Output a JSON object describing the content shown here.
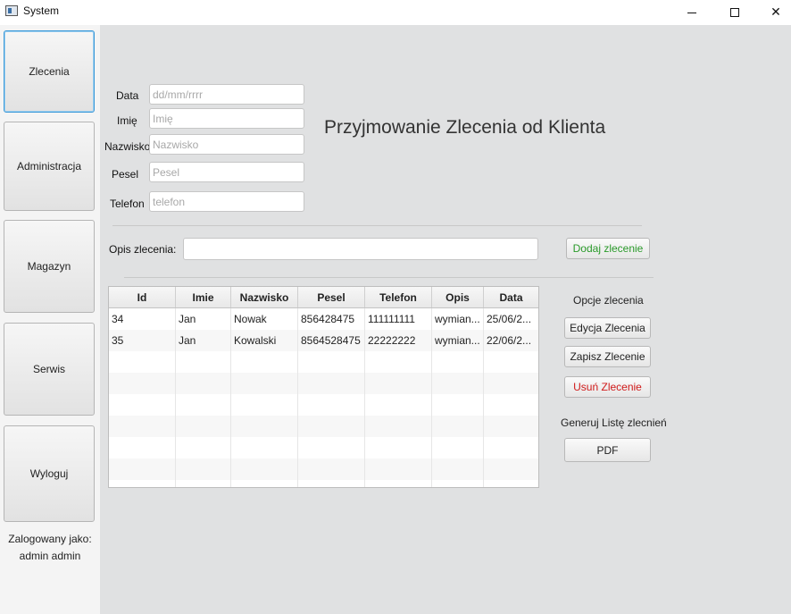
{
  "window": {
    "title": "System",
    "minimize": "",
    "maximize": "",
    "close": "✕"
  },
  "sidebar": {
    "items": [
      {
        "label": "Zlecenia",
        "active": true
      },
      {
        "label": "Administracja"
      },
      {
        "label": "Magazyn"
      },
      {
        "label": "Serwis"
      },
      {
        "label": "Wyloguj"
      }
    ],
    "logged_in_label": "Zalogowany jako:",
    "logged_in_user": "admin admin"
  },
  "form": {
    "date": {
      "label": "Data",
      "value": "",
      "placeholder": "dd/mm/rrrr"
    },
    "first_name": {
      "label": "Imię",
      "value": "",
      "placeholder": "Imię"
    },
    "last_name": {
      "label": "Nazwisko",
      "value": "",
      "placeholder": "Nazwisko"
    },
    "pesel": {
      "label": "Pesel",
      "value": "",
      "placeholder": "Pesel"
    },
    "phone": {
      "label": "Telefon",
      "value": "",
      "placeholder": "telefon"
    },
    "description": {
      "label": "Opis zlecenia:",
      "value": "",
      "placeholder": ""
    },
    "add_button": "Dodaj zlecenie"
  },
  "heading": "Przyjmowanie Zlecenia od Klienta",
  "table": {
    "columns": [
      "Id",
      "Imie",
      "Nazwisko",
      "Pesel",
      "Telefon",
      "Opis",
      "Data"
    ],
    "rows": [
      [
        "34",
        "Jan",
        "Nowak",
        "856428475",
        "111111111",
        "wymian...",
        "25/06/2..."
      ],
      [
        "35",
        "Jan",
        "Kowalski",
        "8564528475",
        "22222222",
        "wymian...",
        "22/06/2..."
      ]
    ]
  },
  "options": {
    "title": "Opcje zlecenia",
    "edit_button": "Edycja Zlecenia",
    "save_button": "Zapisz Zlecenie",
    "delete_button": "Usuń Zlecenie",
    "generate_label": "Generuj Listę zlecnień",
    "pdf_button": "PDF"
  },
  "colors": {
    "accent_focus": "#3b99d8",
    "add_text": "#2a9a2a",
    "delete_text": "#d01a1a",
    "content_bg": "#e0e1e2"
  }
}
